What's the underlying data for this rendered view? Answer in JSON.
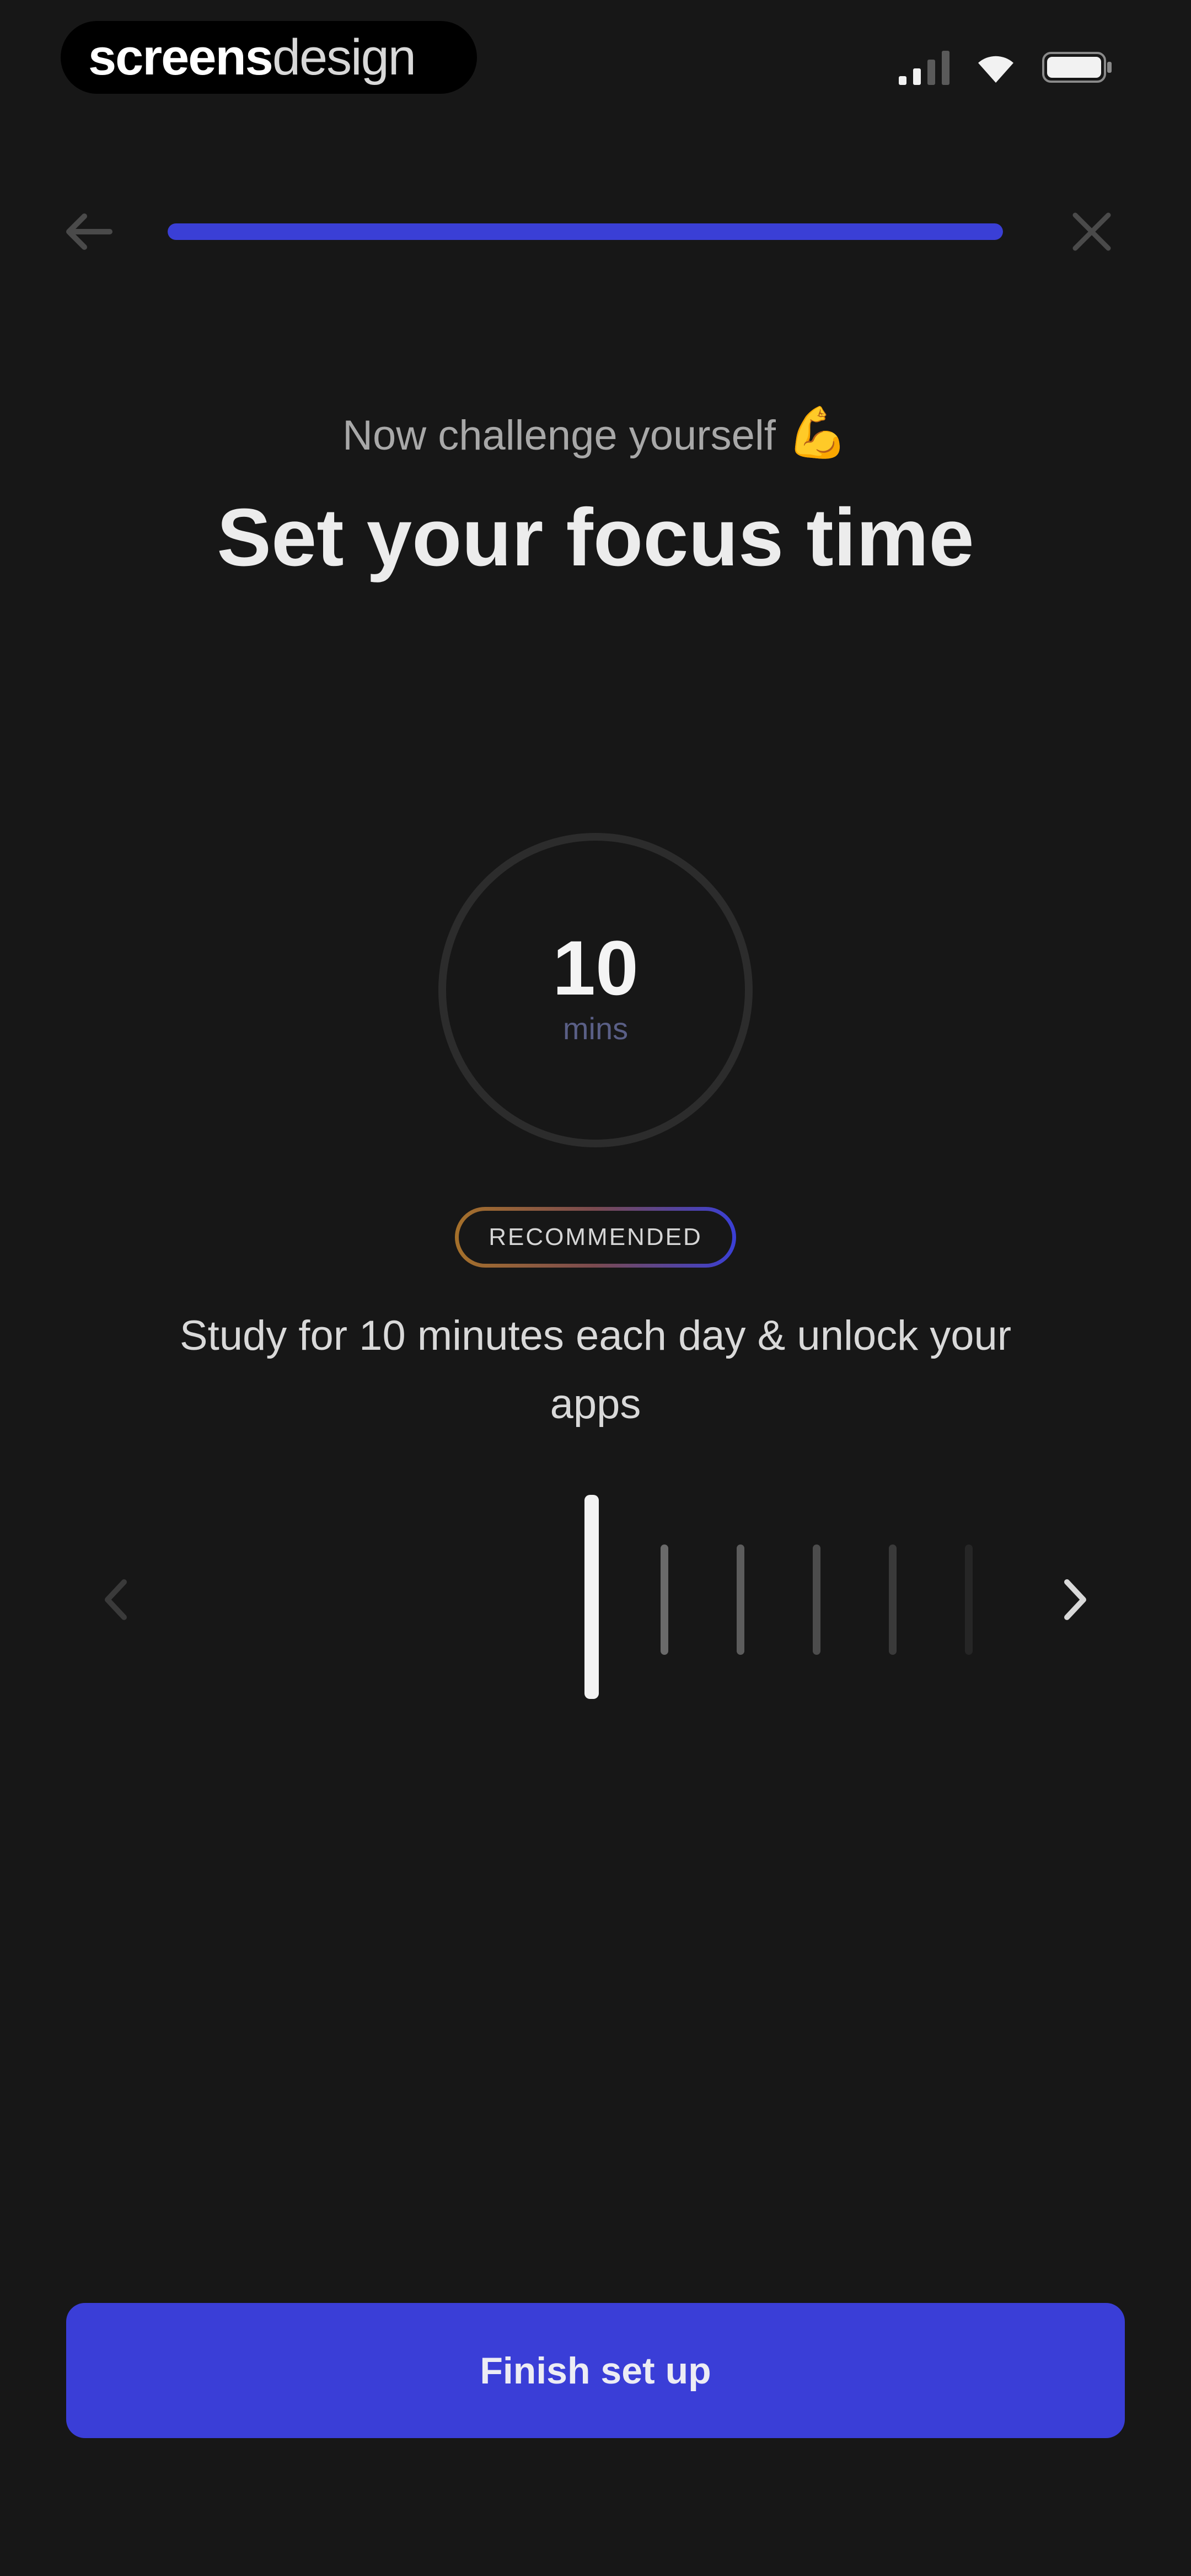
{
  "status_bar": {
    "brand_bold": "screens",
    "brand_light": "design",
    "icons": [
      "signal-icon",
      "wifi-icon",
      "battery-icon"
    ]
  },
  "header": {
    "back_icon": "arrow-left-icon",
    "close_icon": "close-icon",
    "progress": 1.0
  },
  "content": {
    "subtitle": "Now challenge yourself",
    "subtitle_emoji": "💪",
    "title": "Set your focus time",
    "dial_value": "10",
    "dial_unit": "mins",
    "badge": "RECOMMENDED",
    "description": "Study for 10 minutes each day & unlock your apps"
  },
  "slider": {
    "prev_icon": "chevron-left-icon",
    "next_icon": "chevron-right-icon",
    "selected_index": 0
  },
  "footer": {
    "finish_label": "Finish set up"
  },
  "colors": {
    "background": "#171717",
    "accent": "#3a3ed7",
    "badge_gradient_start": "#a5702a",
    "subtitle_text": "#a8a8a8",
    "unit_text": "#5a5f86"
  }
}
